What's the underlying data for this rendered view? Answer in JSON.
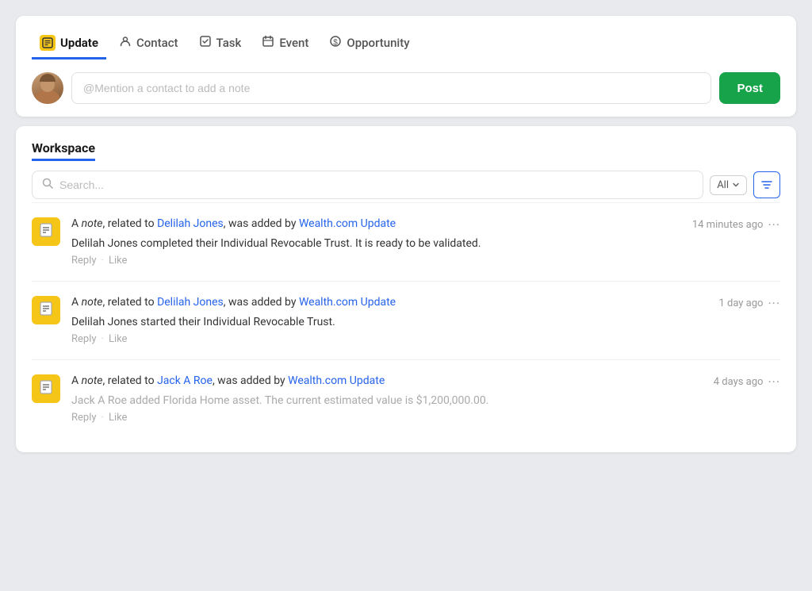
{
  "tabs": [
    {
      "id": "update",
      "label": "Update",
      "active": true,
      "iconType": "box"
    },
    {
      "id": "contact",
      "label": "Contact",
      "active": false,
      "iconType": "person"
    },
    {
      "id": "task",
      "label": "Task",
      "active": false,
      "iconType": "check"
    },
    {
      "id": "event",
      "label": "Event",
      "active": false,
      "iconType": "calendar"
    },
    {
      "id": "opportunity",
      "label": "Opportunity",
      "active": false,
      "iconType": "dollar"
    }
  ],
  "compose": {
    "placeholder": "@Mention a contact to add a note",
    "post_label": "Post"
  },
  "workspace": {
    "title": "Workspace",
    "search_placeholder": "Search...",
    "filter_label": "All"
  },
  "feed": [
    {
      "id": 1,
      "prefix": "A ",
      "note_text": "note",
      "middle": ", related to ",
      "contact_name": "Delilah Jones",
      "suffix": ", was added by ",
      "added_by": "Wealth.com Update",
      "time": "14 minutes ago",
      "body": "Delilah Jones completed their Individual Revocable Trust. It is ready to be validated.",
      "muted": false,
      "reply_label": "Reply",
      "like_label": "Like"
    },
    {
      "id": 2,
      "prefix": "A ",
      "note_text": "note",
      "middle": ", related to ",
      "contact_name": "Delilah Jones",
      "suffix": ", was added by ",
      "added_by": "Wealth.com Update",
      "time": "1 day ago",
      "body": "Delilah Jones started their Individual Revocable Trust.",
      "muted": false,
      "reply_label": "Reply",
      "like_label": "Like"
    },
    {
      "id": 3,
      "prefix": "A ",
      "note_text": "note",
      "middle": ", related to ",
      "contact_name": "Jack A Roe",
      "suffix": ", was added by ",
      "added_by": "Wealth.com Update",
      "time": "4 days ago",
      "body": "Jack A Roe added Florida Home asset. The current estimated value is $1,200,000.00.",
      "muted": true,
      "reply_label": "Reply",
      "like_label": "Like"
    }
  ]
}
